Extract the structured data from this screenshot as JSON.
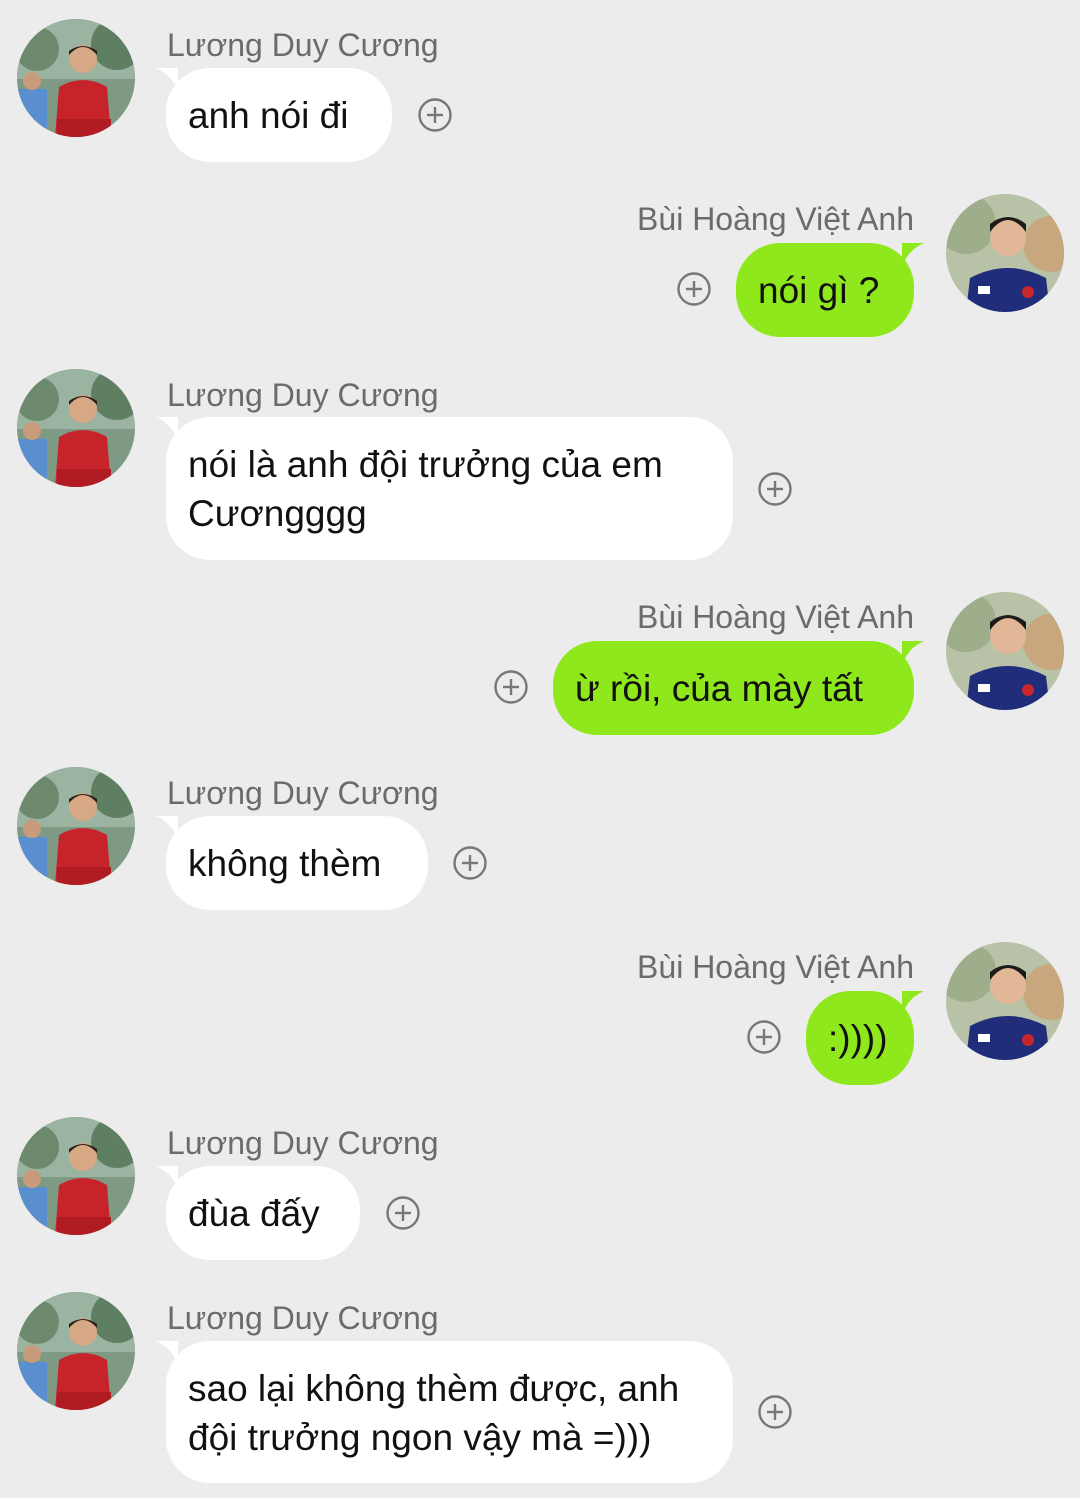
{
  "colors": {
    "background": "#ececec",
    "incoming_bubble": "#ffffff",
    "outgoing_bubble": "#8ee81b",
    "sender_name": "#6b6b6b"
  },
  "messages": [
    {
      "sender": "Lương Duy Cương",
      "direction": "incoming",
      "text": "anh nói đi"
    },
    {
      "sender": "Bùi Hoàng Việt Anh",
      "direction": "outgoing",
      "text": "nói gì ?"
    },
    {
      "sender": "Lương Duy Cương",
      "direction": "incoming",
      "text": "nói là anh đội trưởng của em Cươngggg"
    },
    {
      "sender": "Bùi Hoàng Việt Anh",
      "direction": "outgoing",
      "text": "ừ rồi, của mày tất"
    },
    {
      "sender": "Lương Duy Cương",
      "direction": "incoming",
      "text": "không thèm"
    },
    {
      "sender": "Bùi Hoàng Việt Anh",
      "direction": "outgoing",
      "text": ":))))"
    },
    {
      "sender": "Lương Duy Cương",
      "direction": "incoming",
      "text": "đùa đấy"
    },
    {
      "sender": "Lương Duy Cương",
      "direction": "incoming",
      "text": "sao lại không thèm được, anh đội trưởng ngon vậy mà =)))"
    }
  ],
  "icons": {
    "avatar_incoming": "user-avatar-red-jersey",
    "avatar_outgoing": "user-avatar-blue-jersey",
    "reaction": "add-reaction-icon"
  }
}
